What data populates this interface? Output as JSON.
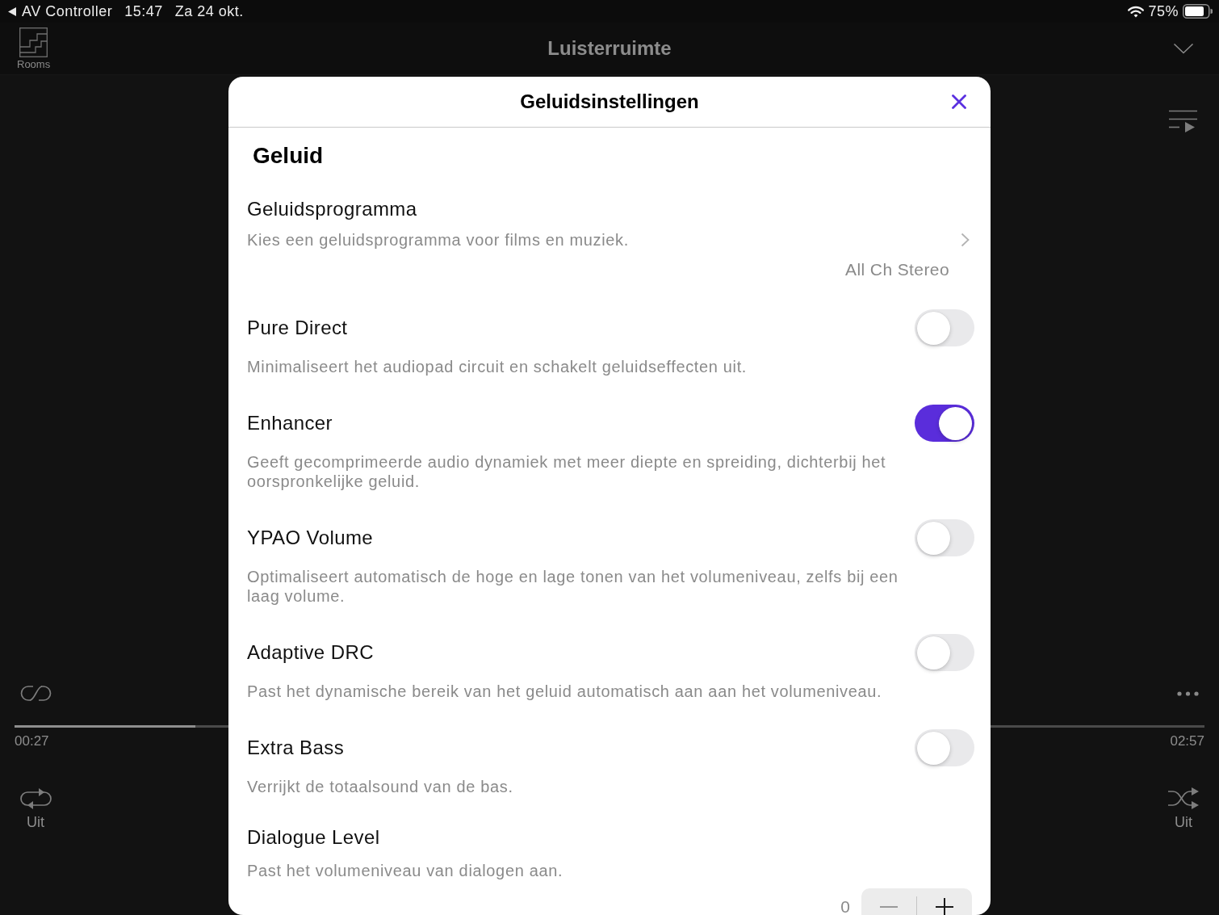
{
  "status_bar": {
    "app": "AV Controller",
    "time": "15:47",
    "date": "Za 24 okt.",
    "battery": "75%"
  },
  "header": {
    "rooms_label": "Rooms",
    "title": "Luisterruimte"
  },
  "player": {
    "progress": {
      "level": 0.152
    },
    "elapsed": "00:27",
    "duration": "02:57",
    "repeat": {
      "label": "Uit"
    },
    "shuffle": {
      "label": "Uit"
    }
  },
  "dialog": {
    "title": "Geluidsinstellingen",
    "section": "Geluid",
    "settings": [
      {
        "kind": "link",
        "label": "Geluidsprogramma",
        "description": "Kies een geluidsprogramma voor films en muziek.",
        "value": "All Ch Stereo"
      },
      {
        "kind": "toggle",
        "label": "Pure Direct",
        "description": "Minimaliseert het audiopad circuit en schakelt geluidseffecten uit.",
        "on": false
      },
      {
        "kind": "toggle",
        "label": "Enhancer",
        "description": "Geeft gecomprimeerde audio dynamiek met meer diepte en spreiding, dichterbij het oorspronkelijke geluid.",
        "on": true
      },
      {
        "kind": "toggle",
        "label": "YPAO Volume",
        "description": "Optimaliseert automatisch de hoge en lage tonen van het volumeniveau, zelfs bij een laag volume.",
        "on": false
      },
      {
        "kind": "toggle",
        "label": "Adaptive DRC",
        "description": "Past het dynamische bereik van het geluid automatisch aan aan het volumeniveau.",
        "on": false
      },
      {
        "kind": "toggle",
        "label": "Extra Bass",
        "description": "Verrijkt de totaalsound van de bas.",
        "on": false
      },
      {
        "kind": "stepper",
        "label": "Dialogue Level",
        "description": "Past het volumeniveau van dialogen aan.",
        "value": "0",
        "decrease_disabled": true
      }
    ]
  }
}
